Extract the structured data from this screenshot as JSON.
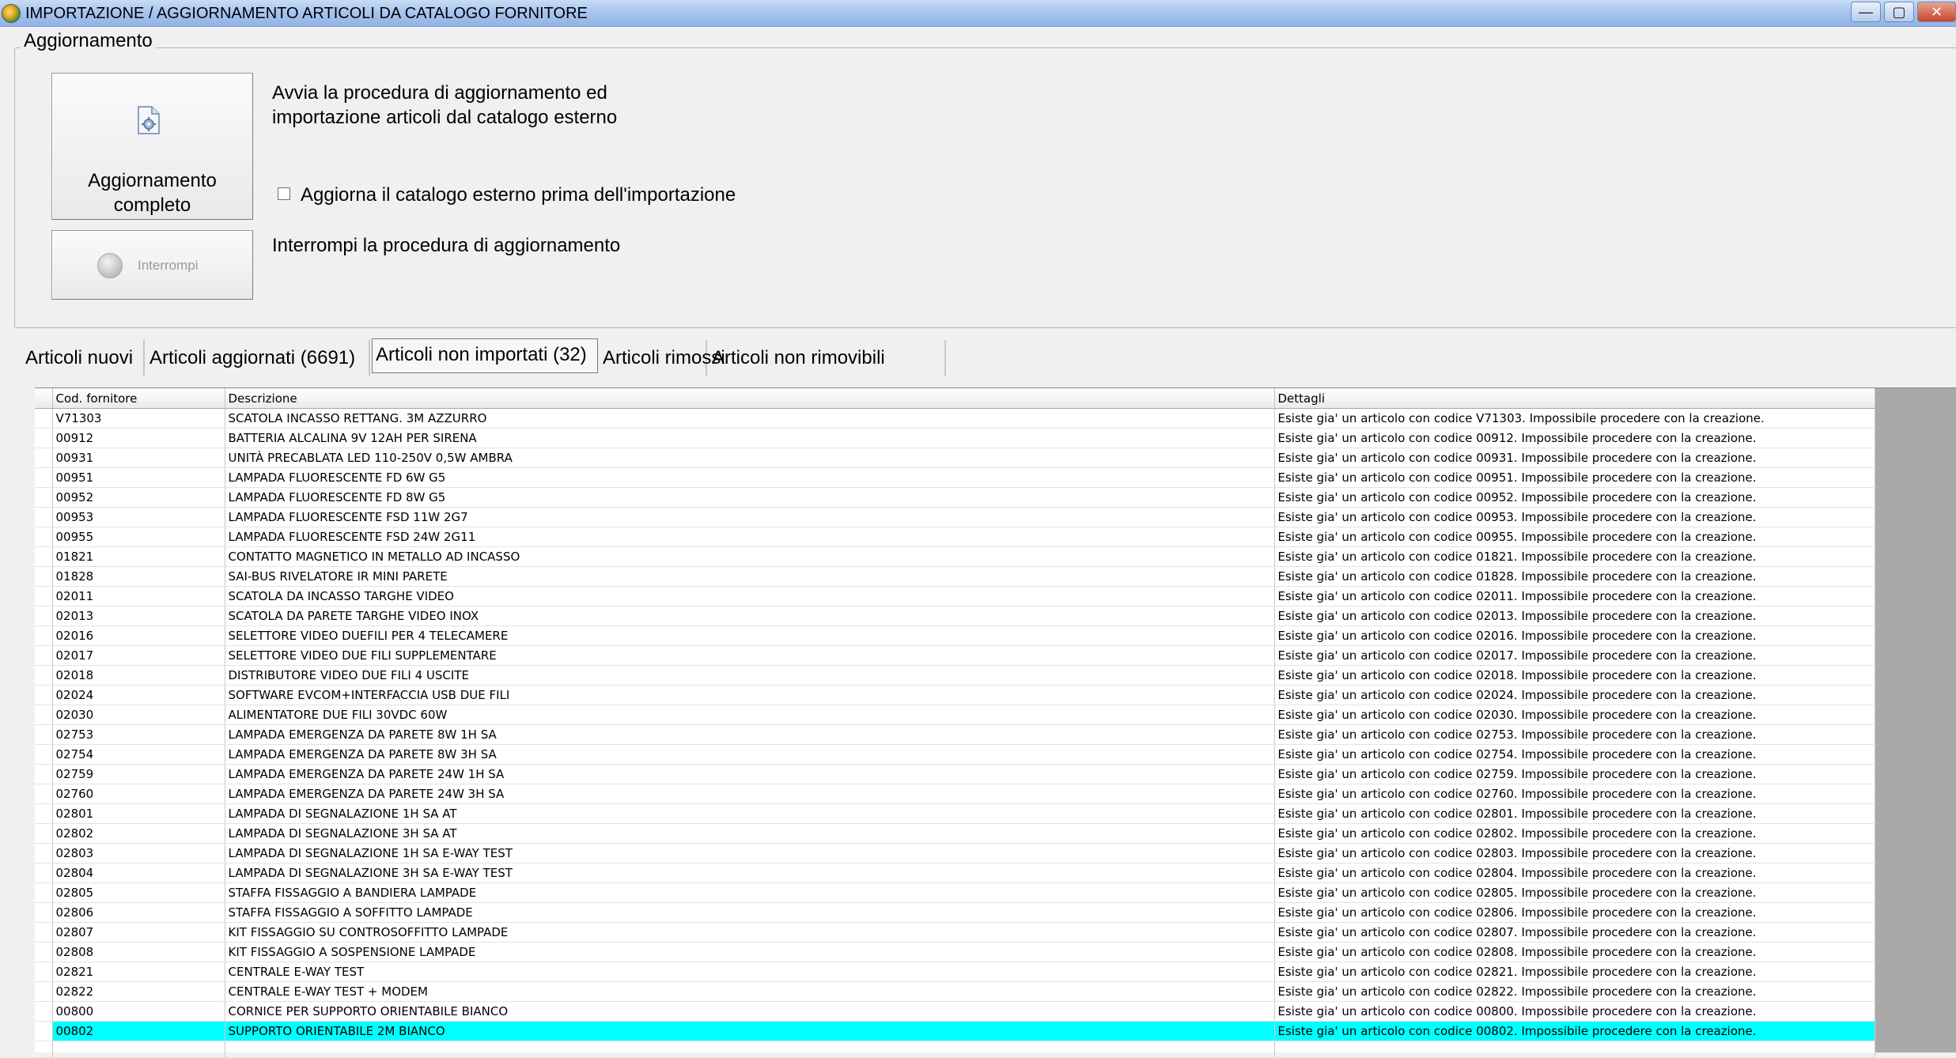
{
  "window": {
    "title": "IMPORTAZIONE / AGGIORNAMENTO ARTICOLI DA CATALOGO FORNITORE",
    "icon": "app-icon",
    "controls": {
      "minimize": "—",
      "maximize": "▢",
      "close": "✕"
    }
  },
  "update_group": {
    "legend": "Aggiornamento",
    "full_update_button": {
      "label": "Aggiornamento\ncompleto",
      "icon": "document-gear-icon"
    },
    "full_update_description": "Avvia la procedura di aggiornamento ed\nimportazione articoli dal catalogo esterno",
    "update_catalog_checkbox": {
      "label": "Aggiorna il catalogo esterno prima dell'importazione",
      "checked": false
    },
    "stop_button": {
      "label": "Interrompi",
      "icon": "stop-icon",
      "enabled": false
    },
    "stop_description": "Interrompi la procedura di aggiornamento"
  },
  "tabs": [
    {
      "label": "Articoli nuovi",
      "active": false
    },
    {
      "label": "Articoli aggiornati (6691)",
      "active": false
    },
    {
      "label": "Articoli non importati (32)",
      "active": true
    },
    {
      "label": "Articoli rimossi",
      "active": false
    },
    {
      "label": "Articoli non rimovibili",
      "active": false
    }
  ],
  "table": {
    "columns": [
      "Cod. fornitore",
      "Descrizione",
      "Dettagli"
    ],
    "selected_index": 31,
    "rows": [
      [
        "V71303",
        "SCATOLA INCASSO RETTANG. 3M AZZURRO",
        "Esiste gia' un articolo con codice V71303. Impossibile procedere con la creazione."
      ],
      [
        "00912",
        "BATTERIA ALCALINA 9V 12AH PER SIRENA",
        "Esiste gia' un articolo con codice 00912. Impossibile procedere con la creazione."
      ],
      [
        "00931",
        "UNITÀ PRECABLATA LED 110-250V 0,5W AMBRA",
        "Esiste gia' un articolo con codice 00931. Impossibile procedere con la creazione."
      ],
      [
        "00951",
        "LAMPADA FLUORESCENTE FD 6W G5",
        "Esiste gia' un articolo con codice 00951. Impossibile procedere con la creazione."
      ],
      [
        "00952",
        "LAMPADA FLUORESCENTE FD 8W G5",
        "Esiste gia' un articolo con codice 00952. Impossibile procedere con la creazione."
      ],
      [
        "00953",
        "LAMPADA FLUORESCENTE FSD 11W 2G7",
        "Esiste gia' un articolo con codice 00953. Impossibile procedere con la creazione."
      ],
      [
        "00955",
        "LAMPADA FLUORESCENTE FSD 24W 2G11",
        "Esiste gia' un articolo con codice 00955. Impossibile procedere con la creazione."
      ],
      [
        "01821",
        "CONTATTO MAGNETICO IN METALLO AD INCASSO",
        "Esiste gia' un articolo con codice 01821. Impossibile procedere con la creazione."
      ],
      [
        "01828",
        "SAI-BUS RIVELATORE IR MINI PARETE",
        "Esiste gia' un articolo con codice 01828. Impossibile procedere con la creazione."
      ],
      [
        "02011",
        "SCATOLA DA INCASSO TARGHE VIDEO",
        "Esiste gia' un articolo con codice 02011. Impossibile procedere con la creazione."
      ],
      [
        "02013",
        "SCATOLA DA PARETE TARGHE VIDEO INOX",
        "Esiste gia' un articolo con codice 02013. Impossibile procedere con la creazione."
      ],
      [
        "02016",
        "SELETTORE VIDEO DUEFILI PER 4 TELECAMERE",
        "Esiste gia' un articolo con codice 02016. Impossibile procedere con la creazione."
      ],
      [
        "02017",
        "SELETTORE VIDEO DUE FILI SUPPLEMENTARE",
        "Esiste gia' un articolo con codice 02017. Impossibile procedere con la creazione."
      ],
      [
        "02018",
        "DISTRIBUTORE VIDEO DUE FILI 4 USCITE",
        "Esiste gia' un articolo con codice 02018. Impossibile procedere con la creazione."
      ],
      [
        "02024",
        "SOFTWARE EVCOM+INTERFACCIA USB DUE FILI",
        "Esiste gia' un articolo con codice 02024. Impossibile procedere con la creazione."
      ],
      [
        "02030",
        "ALIMENTATORE DUE FILI 30VDC 60W",
        "Esiste gia' un articolo con codice 02030. Impossibile procedere con la creazione."
      ],
      [
        "02753",
        "LAMPADA EMERGENZA DA PARETE 8W 1H SA",
        "Esiste gia' un articolo con codice 02753. Impossibile procedere con la creazione."
      ],
      [
        "02754",
        "LAMPADA EMERGENZA DA PARETE 8W 3H SA",
        "Esiste gia' un articolo con codice 02754. Impossibile procedere con la creazione."
      ],
      [
        "02759",
        "LAMPADA EMERGENZA DA PARETE 24W 1H SA",
        "Esiste gia' un articolo con codice 02759. Impossibile procedere con la creazione."
      ],
      [
        "02760",
        "LAMPADA EMERGENZA DA PARETE 24W 3H SA",
        "Esiste gia' un articolo con codice 02760. Impossibile procedere con la creazione."
      ],
      [
        "02801",
        "LAMPADA DI SEGNALAZIONE 1H SA AT",
        "Esiste gia' un articolo con codice 02801. Impossibile procedere con la creazione."
      ],
      [
        "02802",
        "LAMPADA DI SEGNALAZIONE 3H SA AT",
        "Esiste gia' un articolo con codice 02802. Impossibile procedere con la creazione."
      ],
      [
        "02803",
        "LAMPADA DI SEGNALAZIONE 1H SA E-WAY TEST",
        "Esiste gia' un articolo con codice 02803. Impossibile procedere con la creazione."
      ],
      [
        "02804",
        "LAMPADA DI SEGNALAZIONE 3H SA E-WAY TEST",
        "Esiste gia' un articolo con codice 02804. Impossibile procedere con la creazione."
      ],
      [
        "02805",
        "STAFFA FISSAGGIO A BANDIERA LAMPADE",
        "Esiste gia' un articolo con codice 02805. Impossibile procedere con la creazione."
      ],
      [
        "02806",
        "STAFFA FISSAGGIO A SOFFITTO LAMPADE",
        "Esiste gia' un articolo con codice 02806. Impossibile procedere con la creazione."
      ],
      [
        "02807",
        "KIT FISSAGGIO SU CONTROSOFFITTO LAMPADE",
        "Esiste gia' un articolo con codice 02807. Impossibile procedere con la creazione."
      ],
      [
        "02808",
        "KIT FISSAGGIO A SOSPENSIONE LAMPADE",
        "Esiste gia' un articolo con codice 02808. Impossibile procedere con la creazione."
      ],
      [
        "02821",
        "CENTRALE E-WAY TEST",
        "Esiste gia' un articolo con codice 02821. Impossibile procedere con la creazione."
      ],
      [
        "02822",
        "CENTRALE E-WAY TEST + MODEM",
        "Esiste gia' un articolo con codice 02822. Impossibile procedere con la creazione."
      ],
      [
        "00800",
        "CORNICE PER SUPPORTO ORIENTABILE BIANCO",
        "Esiste gia' un articolo con codice 00800. Impossibile procedere con la creazione."
      ],
      [
        "00802",
        "SUPPORTO ORIENTABILE 2M BIANCO",
        "Esiste gia' un articolo con codice 00802. Impossibile procedere con la creazione."
      ]
    ]
  },
  "colors": {
    "selected_row": "#00ffff",
    "grid_background": "#a9a9a9",
    "titlebar": "#a9c6ee"
  }
}
